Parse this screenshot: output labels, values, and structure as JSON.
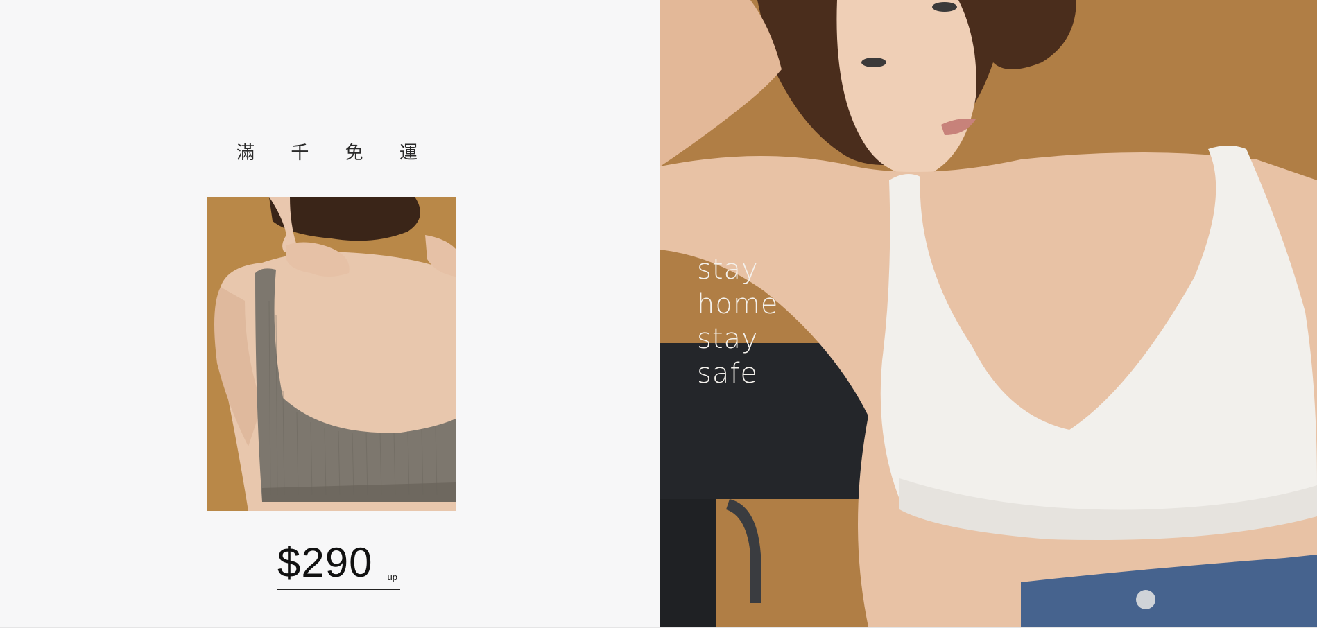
{
  "promo": {
    "headline": "滿 千 免 運"
  },
  "product": {
    "price": "$290",
    "price_suffix": "up"
  },
  "hero": {
    "slogan": [
      "stay",
      "home",
      "stay",
      "safe"
    ]
  },
  "colors": {
    "background": "#f7f7f8",
    "photo_backdrop": "#b07e45",
    "price_text": "#111111",
    "slogan_text": "#f4f1ec"
  }
}
